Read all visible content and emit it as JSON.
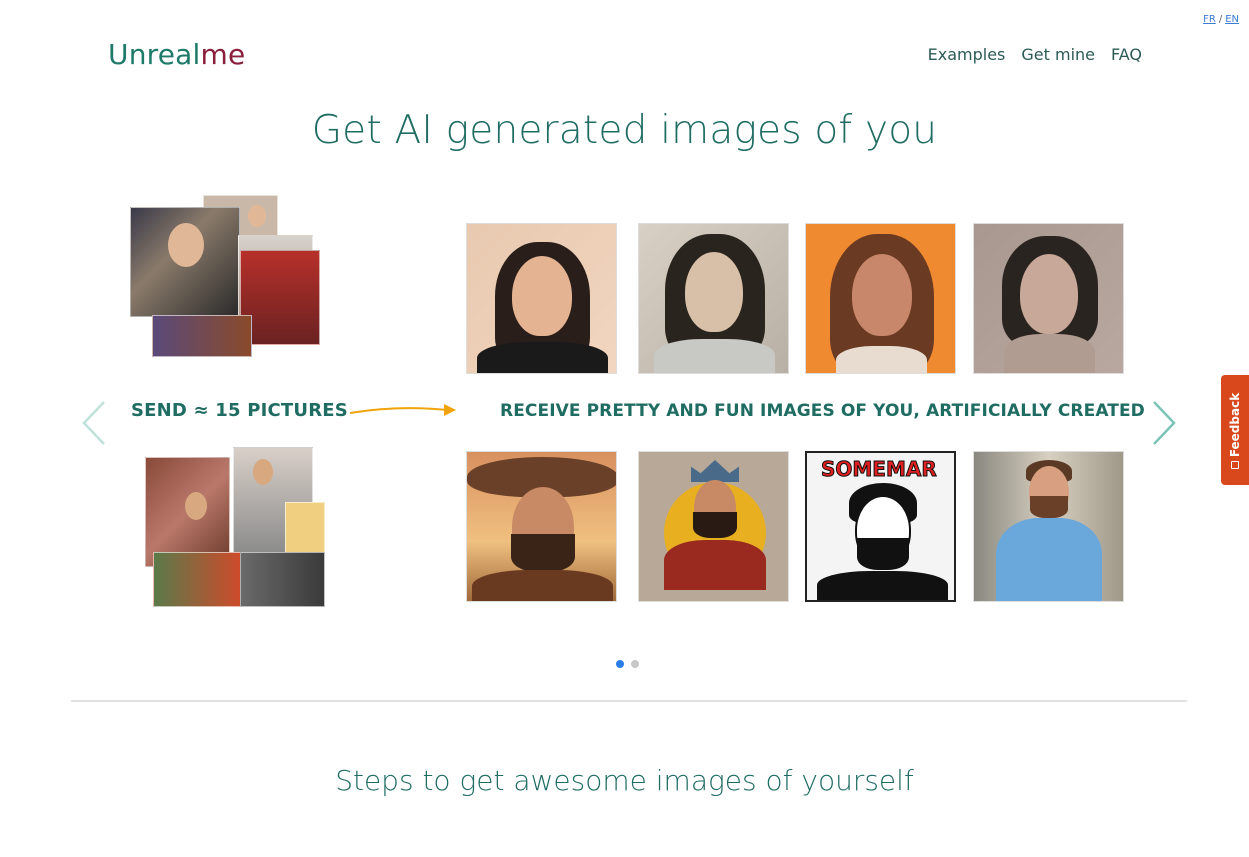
{
  "lang": {
    "fr": "FR",
    "separator": "/",
    "en": "EN"
  },
  "header": {
    "logo_part1": "Unreal",
    "logo_part2": "me"
  },
  "nav": {
    "items": [
      {
        "label": "Examples"
      },
      {
        "label": "Get mine"
      },
      {
        "label": "FAQ"
      }
    ]
  },
  "hero": {
    "title": "Get AI generated images of you"
  },
  "carousel": {
    "send_label": "SEND ≈ 15 PICTURES",
    "receive_label": "RECEIVE PRETTY AND FUN IMAGES OF YOU, ARTIFICIALLY CREATED",
    "top_row_caption": "SOMEMAR",
    "active_slide": 1,
    "slide_count": 2
  },
  "colors": {
    "accent": "#1f6c63",
    "logo_me": "#8a1f3c",
    "arrow": "#f0a30a",
    "nav_arrow": "#7cc4b6",
    "dot_active": "#2b7de9",
    "dot_inactive": "#c8c8c8",
    "feedback": "#d9481c"
  },
  "steps": {
    "title": "Steps to get awesome images of yourself"
  },
  "feedback": {
    "label": "Feedback"
  }
}
